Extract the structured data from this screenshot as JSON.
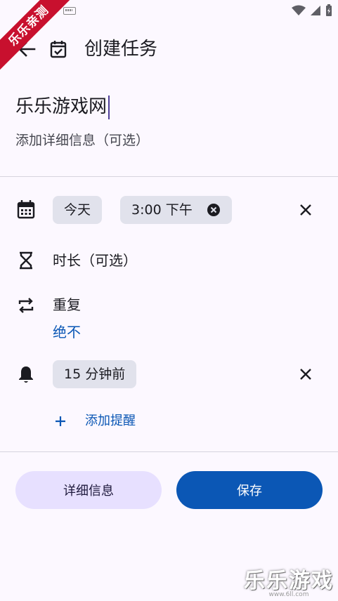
{
  "watermark": {
    "ribbon_text": "乐乐亲测",
    "bottom_text": "乐乐游戏",
    "bottom_url": "www.6ll.com"
  },
  "header": {
    "title": "创建任务"
  },
  "task": {
    "title_value": "乐乐游戏网",
    "description_placeholder": "添加详细信息（可选）"
  },
  "schedule": {
    "date_chip": "今天",
    "time_chip": "3:00 下午",
    "duration_placeholder": "时长（可选）",
    "repeat_label": "重复",
    "repeat_value": "绝不",
    "reminder_chip": "15 分钟前",
    "add_reminder": "添加提醒"
  },
  "actions": {
    "details_label": "详细信息",
    "save_label": "保存"
  },
  "colors": {
    "background": "#fcf8ff",
    "chip": "#e1e2ec",
    "primary": "#0b57b5",
    "secondary_button": "#e7e0ff",
    "ribbon": "#c8102e"
  }
}
